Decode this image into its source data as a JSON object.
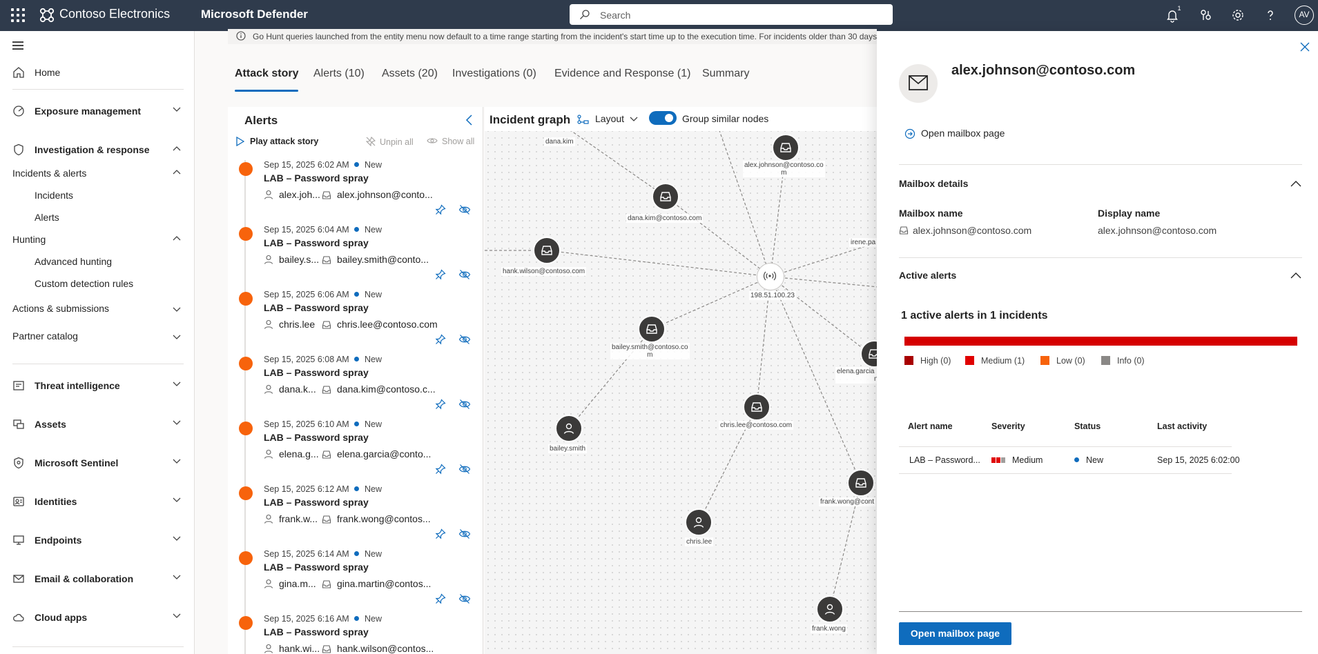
{
  "topbar": {
    "org": "Contoso Electronics",
    "product": "Microsoft Defender",
    "search_placeholder": "Search",
    "notification_count": "1",
    "avatar_initials": "AV"
  },
  "sidenav": {
    "home": "Home",
    "exposure": "Exposure management",
    "investigation": "Investigation & response",
    "incidents_alerts": "Incidents & alerts",
    "incidents": "Incidents",
    "alerts": "Alerts",
    "hunting": "Hunting",
    "advanced_hunting": "Advanced hunting",
    "custom_detection": "Custom detection rules",
    "actions": "Actions & submissions",
    "partner": "Partner catalog",
    "threat_intel": "Threat intelligence",
    "assets": "Assets",
    "sentinel": "Microsoft Sentinel",
    "identities": "Identities",
    "endpoints": "Endpoints",
    "email": "Email & collaboration",
    "cloud_apps": "Cloud apps"
  },
  "info_bar": "Go Hunt queries launched from the entity menu now default to a time range starting from the incident's start time up to the execution time. For incidents older than 30 days",
  "tabs": [
    "Attack story",
    "Alerts (10)",
    "Assets (20)",
    "Investigations (0)",
    "Evidence and Response (1)",
    "Summary"
  ],
  "alerts_panel": {
    "title": "Alerts",
    "play": "Play attack story",
    "unpin": "Unpin all",
    "show_all": "Show all",
    "items": [
      {
        "date": "Sep 15, 2025 6:02 AM",
        "status": "New",
        "title": "LAB – Password spray",
        "user": "alex.joh...",
        "mailbox": "alex.johnson@conto..."
      },
      {
        "date": "Sep 15, 2025 6:04 AM",
        "status": "New",
        "title": "LAB – Password spray",
        "user": "bailey.s...",
        "mailbox": "bailey.smith@conto..."
      },
      {
        "date": "Sep 15, 2025 6:06 AM",
        "status": "New",
        "title": "LAB – Password spray",
        "user": "chris.lee",
        "mailbox": "chris.lee@contoso.com"
      },
      {
        "date": "Sep 15, 2025 6:08 AM",
        "status": "New",
        "title": "LAB – Password spray",
        "user": "dana.k...",
        "mailbox": "dana.kim@contoso.c..."
      },
      {
        "date": "Sep 15, 2025 6:10 AM",
        "status": "New",
        "title": "LAB – Password spray",
        "user": "elena.g...",
        "mailbox": "elena.garcia@conto..."
      },
      {
        "date": "Sep 15, 2025 6:12 AM",
        "status": "New",
        "title": "LAB – Password spray",
        "user": "frank.w...",
        "mailbox": "frank.wong@contos..."
      },
      {
        "date": "Sep 15, 2025 6:14 AM",
        "status": "New",
        "title": "LAB – Password spray",
        "user": "gina.m...",
        "mailbox": "gina.martin@contos..."
      },
      {
        "date": "Sep 15, 2025 6:16 AM",
        "status": "New",
        "title": "LAB – Password spray",
        "user": "hank.wi...",
        "mailbox": "hank.wilson@contos..."
      }
    ]
  },
  "graph": {
    "title": "Incident graph",
    "layout": "Layout",
    "group_similar": "Group similar nodes",
    "labels": {
      "dana_kim": "dana.kim",
      "alex_mb_1": "alex.johnson@contoso.co",
      "alex_mb_2": "m",
      "dana_mb": "dana.kim@contoso.com",
      "hank_mb": "hank.wilson@contoso.com",
      "irene": "irene.pa",
      "ip": "198.51.100.23",
      "bailey_mb_1": "bailey.smith@contoso.co",
      "bailey_mb_2": "m",
      "elena_1": "elena.garcia",
      "elena_2": "n",
      "chris_mb": "chris.lee@contoso.com",
      "bailey": "bailey.smith",
      "frank_mb": "frank.wong@cont",
      "chris": "chris.lee",
      "frank": "frank.wong"
    }
  },
  "flyout": {
    "entity": "alex.johnson@contoso.com",
    "open_link": "Open mailbox page",
    "mailbox_details": "Mailbox details",
    "mailbox_name_label": "Mailbox name",
    "mailbox_name": "alex.johnson@contoso.com",
    "display_name_label": "Display name",
    "display_name": "alex.johnson@contoso.com",
    "active_alerts": "Active alerts",
    "active_summary": "1 active alerts in 1 incidents",
    "legend": [
      "High (0)",
      "Medium (1)",
      "Low (0)",
      "Info (0)"
    ],
    "columns": [
      "Alert name",
      "Severity",
      "Status",
      "Last activity"
    ],
    "row": {
      "name": "LAB – Password...",
      "severity": "Medium",
      "status": "New",
      "last": "Sep 15, 2025 6:02:00"
    },
    "primary_button": "Open mailbox page"
  },
  "colors": {
    "topbar": "#2f3b4c",
    "accent": "#0f6cbd",
    "alert_dot": "#f7630c",
    "high": "#a80000",
    "medium": "#d50000",
    "low": "#f7630c",
    "info": "#8a8886"
  }
}
